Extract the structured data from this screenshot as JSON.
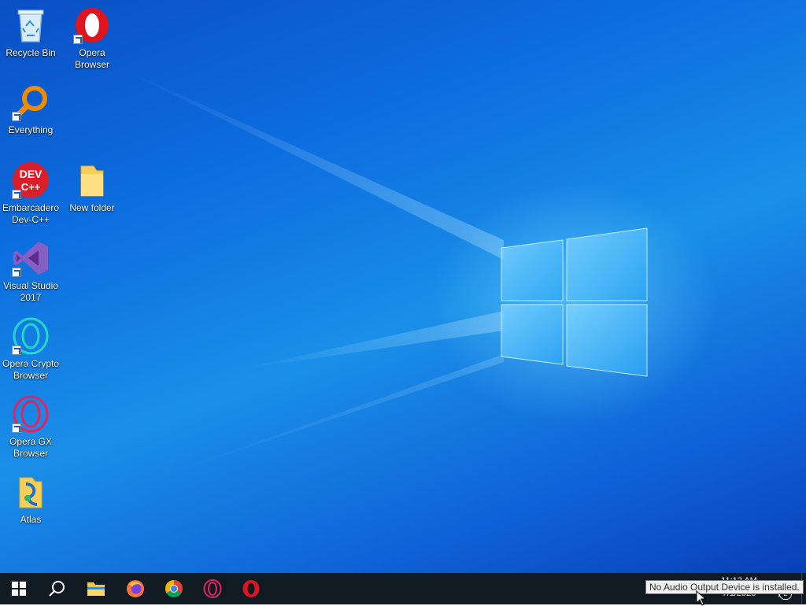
{
  "desktop": {
    "icons": [
      {
        "label": "Recycle Bin",
        "icon": "recycle-bin-icon"
      },
      {
        "label": "Opera Browser",
        "icon": "opera-icon"
      },
      {
        "label": "Everything",
        "icon": "everything-search-icon"
      },
      {
        "label": "Embarcadero Dev-C++",
        "icon": "devcpp-icon",
        "badge": "DEV C++"
      },
      {
        "label": "New folder",
        "icon": "folder-icon"
      },
      {
        "label": "Visual Studio 2017",
        "icon": "visual-studio-icon"
      },
      {
        "label": "Opera Crypto Browser",
        "icon": "opera-crypto-icon"
      },
      {
        "label": "Opera GX Browser",
        "icon": "opera-gx-icon"
      },
      {
        "label": "Atlas",
        "icon": "atlas-icon"
      }
    ]
  },
  "taskbar": {
    "buttons": [
      {
        "name": "start",
        "icon": "windows-logo-icon"
      },
      {
        "name": "search",
        "icon": "search-icon"
      },
      {
        "name": "file-explorer",
        "icon": "folder-icon"
      },
      {
        "name": "firefox",
        "icon": "firefox-icon"
      },
      {
        "name": "chrome",
        "icon": "chrome-icon"
      },
      {
        "name": "opera-gx",
        "icon": "opera-gx-icon"
      },
      {
        "name": "opera",
        "icon": "opera-icon"
      }
    ],
    "clock": {
      "time": "11:12 AM",
      "date": "7/1/2023"
    },
    "notification_count": "2",
    "tooltip": "No Audio Output Device is installed."
  },
  "colors": {
    "taskbar_bg": "#101a22",
    "desktop_blue": "#0d6fe0",
    "opera_red": "#e0141e",
    "opera_gx_pink": "#e0245e"
  }
}
